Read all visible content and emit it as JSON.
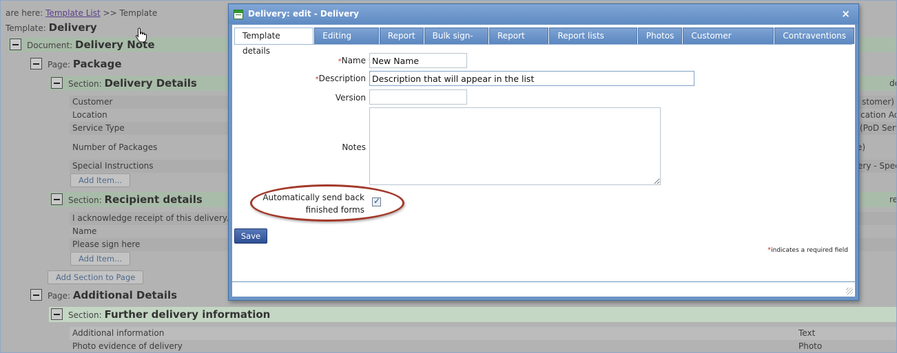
{
  "background": {
    "breadcrumb": {
      "prefix": "are here:",
      "link": "Template List",
      "sep": ">>",
      "current": "Template"
    },
    "template_title": {
      "label": "Template:",
      "value": "Delivery"
    },
    "document": {
      "label": "Document:",
      "value": "Delivery Note"
    },
    "page1": {
      "label": "Page:",
      "value": "Package"
    },
    "section1": {
      "label": "Section:",
      "value": "Delivery Details",
      "items": [
        "Customer",
        "Location",
        "Service Type",
        "Number of Packages",
        "Special Instructions"
      ],
      "right_fragments": [
        "de",
        "stomer)",
        "cation Ad",
        "(PoD Serv",
        "e)",
        "ery - Spec"
      ],
      "add_item": "Add Item..."
    },
    "section2": {
      "label": "Section:",
      "value": "Recipient details",
      "items": [
        "I acknowledge receipt of this delivery.",
        "Name",
        "Please sign here"
      ],
      "right_fragment": "re",
      "add_item": "Add Item..."
    },
    "add_section": "Add Section to Page",
    "page2": {
      "label": "Page:",
      "value": "Additional Details"
    },
    "section3": {
      "label": "Section:",
      "value": "Further delivery information",
      "items": [
        "Additional information",
        "Photo evidence of delivery"
      ],
      "types": [
        "Text",
        "Photo"
      ]
    }
  },
  "dialog": {
    "title": "Delivery: edit - Delivery",
    "close": "×",
    "tabs": [
      "Template details",
      "Editing rules",
      "Report",
      "Bulk sign-off",
      "Report lists",
      "Report lists (more)",
      "Photos",
      "Customer response",
      "Contraventions"
    ],
    "active_tab": 0,
    "form": {
      "name_label": "Name",
      "name_value": "New Name",
      "description_label": "Description",
      "description_value": "Description that will appear in the list",
      "version_label": "Version",
      "version_value": "",
      "notes_label": "Notes",
      "notes_value": "",
      "auto_send_label": "Automatically send back finished forms",
      "auto_send_line1": "Automatically send back",
      "auto_send_line2": "finished forms",
      "auto_send_checked": true,
      "required_marker": "*"
    },
    "save_label": "Save",
    "required_note": "indicates a required field"
  },
  "colors": {
    "titlebar": "#6d94c4",
    "save_button": "#2e4f93",
    "highlight_oval": "#a3392b",
    "section_band": "#a9bba9"
  }
}
